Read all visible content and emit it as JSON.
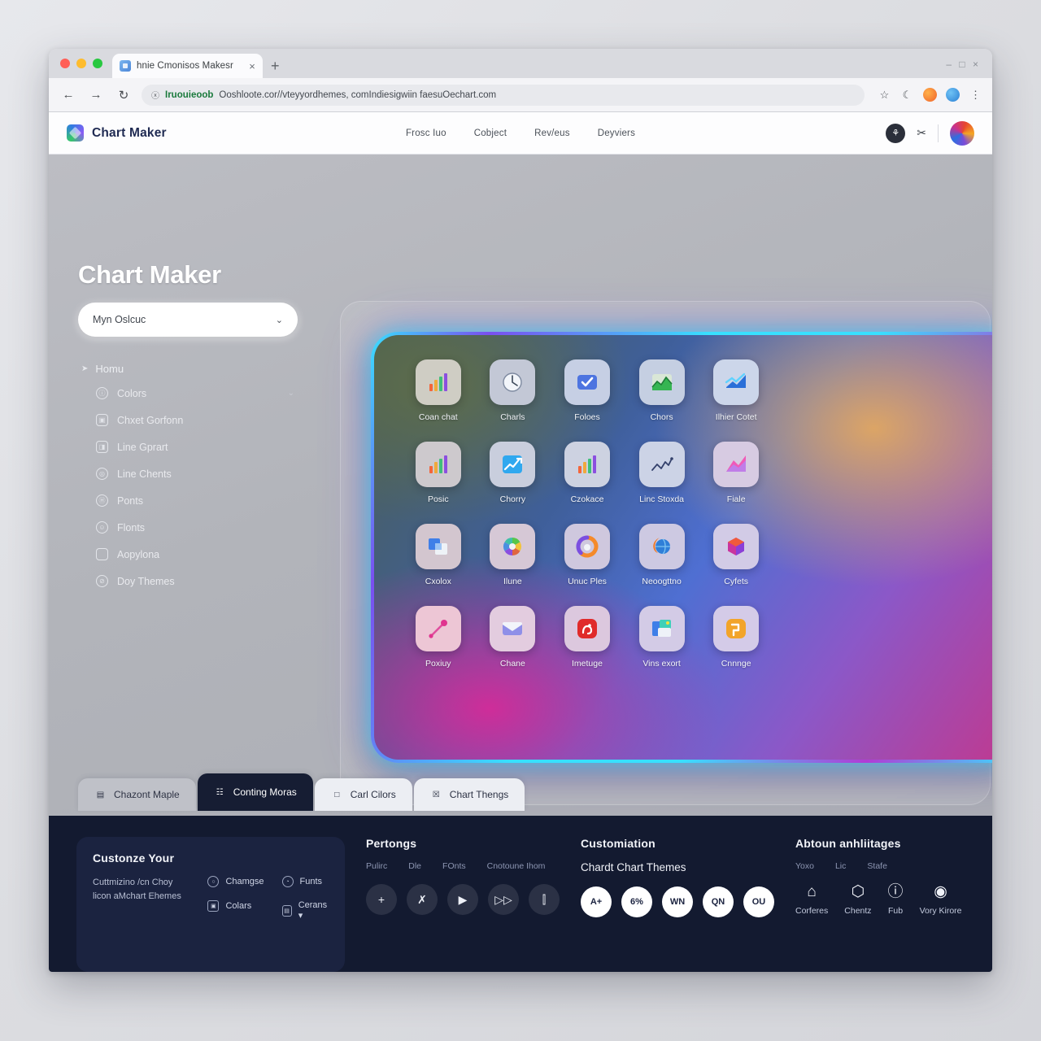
{
  "browser": {
    "tab_title": "hnie Cmonisos Makesr",
    "tab_close": "×",
    "new_tab": "+",
    "window_controls": "– □ ×",
    "back": "←",
    "forward": "→",
    "reload": "↻",
    "lock_icon": "ⓧ",
    "url_host": "Iruouieoob",
    "url_rest": "Ooshloote.cor//vteyyordhemes, comIndiesigwiin faesuOechart.com",
    "toolbar_icons": [
      "star-icon",
      "crescent-icon",
      "extension-orange-icon",
      "extension-blue-icon",
      "menu-kebab-icon"
    ],
    "star": "☆",
    "crescent": "☾",
    "kebab": "⋮"
  },
  "header": {
    "brand": "Chart Maker",
    "nav": [
      "Frosc Iuo",
      "Cobject",
      "Rev/eus",
      "Deyviers"
    ],
    "circle_icon": "⚘",
    "shear_icon": "✂",
    "avatar": "user-avatar"
  },
  "sidebar": {
    "title": "Chart Maker",
    "select_value": "Myn Oslcuc",
    "select_chevron": "⌄",
    "menu_head": "Homu",
    "menu_head_icon": "➤",
    "items": [
      {
        "label": "Colors",
        "icon": "ⓘ",
        "shape": "circ",
        "trail": "⌄"
      },
      {
        "label": "Chxet Gorfonn",
        "icon": "▣",
        "shape": "sq",
        "trail": ""
      },
      {
        "label": "Line Gprart",
        "icon": "◨",
        "shape": "sq",
        "trail": ""
      },
      {
        "label": "Line Chents",
        "icon": "◎",
        "shape": "circ",
        "trail": ""
      },
      {
        "label": "Ponts",
        "icon": "Ⓗ",
        "shape": "circ",
        "trail": ""
      },
      {
        "label": "Flonts",
        "icon": "☺",
        "shape": "circ",
        "trail": ""
      },
      {
        "label": "Aopylona",
        "icon": "",
        "shape": "sq",
        "trail": ""
      },
      {
        "label": "Doy Themes",
        "icon": "⊘",
        "shape": "circ",
        "trail": ""
      }
    ]
  },
  "gallery": {
    "tiles": [
      {
        "label": "Coan chat",
        "icon": "bar-chart-icon",
        "bg": "#cfcdc4"
      },
      {
        "label": "Charls",
        "icon": "clock-icon",
        "bg": "#c3c8d6"
      },
      {
        "label": "Foloes",
        "icon": "check-card-icon",
        "bg": "#c6cfe4"
      },
      {
        "label": "Chors",
        "icon": "area-chart-icon",
        "bg": "#c5cfe2"
      },
      {
        "label": "Ilhier Cotet",
        "icon": "trend-up-icon",
        "bg": "#ccd6ea"
      },
      {
        "label": "Posic",
        "icon": "bar-chart-icon",
        "bg": "#cdc9cd"
      },
      {
        "label": "Chorry",
        "icon": "line-growth-icon",
        "bg": "#c9cedd"
      },
      {
        "label": "Czokace",
        "icon": "bar-chart-icon",
        "bg": "#cdd2e1"
      },
      {
        "label": "Linc Stoxda",
        "icon": "zigzag-line-icon",
        "bg": "#ccd3e6"
      },
      {
        "label": "Fiale",
        "icon": "pink-fold-icon",
        "bg": "#d7cbe2"
      },
      {
        "label": "Cxolox",
        "icon": "blue-folder-icon",
        "bg": "#d3c6cf"
      },
      {
        "label": "Ilune",
        "icon": "color-wheel-icon",
        "bg": "#d6c8d6"
      },
      {
        "label": "Unuc Ples",
        "icon": "orange-ring-icon",
        "bg": "#cfc8de"
      },
      {
        "label": "Neoogttno",
        "icon": "globe-flame-icon",
        "bg": "#cdc9e2"
      },
      {
        "label": "Cyfets",
        "icon": "cube-icon",
        "bg": "#d2cbe6"
      },
      {
        "label": "Poxiuy",
        "icon": "pin-line-icon",
        "bg": "#edc6d5"
      },
      {
        "label": "Chane",
        "icon": "envelope-icon",
        "bg": "#e3ccdf"
      },
      {
        "label": "Imetuge",
        "icon": "red-badge-icon",
        "bg": "#dcc8de"
      },
      {
        "label": "Vins exort",
        "icon": "photo-stack-icon",
        "bg": "#d3cbe6"
      },
      {
        "label": "Cnnnge",
        "icon": "orange-tool-icon",
        "bg": "#d4cbe8"
      }
    ]
  },
  "tabs": [
    {
      "label": "Chazont Maple",
      "icon": "▤",
      "state": "dim"
    },
    {
      "label": "Conting Moras",
      "icon": "☷",
      "state": "active"
    },
    {
      "label": "Carl Cilors",
      "icon": "□",
      "state": "normal"
    },
    {
      "label": "Chart Thengs",
      "icon": "☒",
      "state": "normal"
    }
  ],
  "footer": {
    "col1": {
      "heading": "Custonze Your",
      "desc": "Cuttmizino /cn Choy licon aMchart Ehemes",
      "links_a": [
        {
          "label": "Chamgse",
          "icon": "○",
          "shape": "circ"
        },
        {
          "label": "Colars",
          "icon": "▣",
          "shape": "sq"
        }
      ],
      "links_b": [
        {
          "label": "Funts",
          "icon": "◔",
          "shape": "circ"
        },
        {
          "label": "Cerans ▾",
          "icon": "▤",
          "shape": "sq"
        }
      ]
    },
    "col2": {
      "heading": "Pertongs",
      "sublabels": [
        "Pulirc",
        "Dle",
        "FOnts",
        "Cnotoune Ihom"
      ],
      "circles": [
        "+",
        "✗",
        "▶",
        "▷▷",
        "⫿"
      ]
    },
    "col3": {
      "heading": "Customiation",
      "subheading": "Chardt Chart Themes",
      "badges": [
        "A+",
        "6%",
        "WN",
        "QN",
        "OU"
      ]
    },
    "col4": {
      "heading": "Abtoun anhliitages",
      "sublabels": [
        "Yoxo",
        "Lic",
        "Stafe"
      ],
      "items": [
        {
          "label": "Corferes",
          "icon": "⌂",
          "name": "home-icon"
        },
        {
          "label": "Chentz",
          "icon": "⬡",
          "name": "shield-grid-icon"
        },
        {
          "label": "Fub",
          "icon": "ⓘ",
          "name": "badge-icon"
        },
        {
          "label": "Vory Kirore",
          "icon": "◉",
          "name": "shield-icon"
        }
      ]
    }
  },
  "colors": {
    "neon_cyan": "#38e0ff",
    "neon_purple": "#7a4ff0",
    "footer_bg": "#131a30",
    "card_bg": "#1b2340",
    "brand_text": "#1f2a52"
  }
}
